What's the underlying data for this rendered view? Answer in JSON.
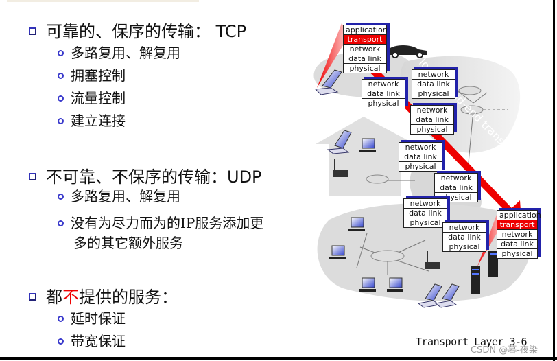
{
  "slide": {
    "sections": [
      {
        "heading": "可靠的、保序的传输： ",
        "heading_suffix": "TCP",
        "items": [
          "多路复用、解复用",
          "拥塞控制",
          "流量控制",
          "建立连接"
        ]
      },
      {
        "heading": "不可靠、不保序的传输：",
        "heading_suffix": "UDP",
        "items": [
          "多路复用、解复用",
          "没有为尽力而为的IP服务添加更",
          "多的其它额外服务"
        ]
      },
      {
        "heading_pre": "都",
        "heading_red": "不",
        "heading_post": "提供的服务：",
        "items": [
          "延时保证",
          "带宽保证"
        ]
      }
    ],
    "footer": "Transport Layer   3-6",
    "watermark": "CSDN @暮-夜染"
  },
  "diagram": {
    "arrow_label": "logical end-end transport",
    "colors": {
      "accent": "#ee0000",
      "stack_shadow": "#2222aa",
      "cloud": "#d9d9d9"
    },
    "sender_stack": [
      "application",
      "transport",
      "network",
      "data link",
      "physical"
    ],
    "receiver_stack": [
      "application",
      "transport",
      "network",
      "data link",
      "physical"
    ],
    "router_stack": [
      "network",
      "data link",
      "physical"
    ]
  }
}
